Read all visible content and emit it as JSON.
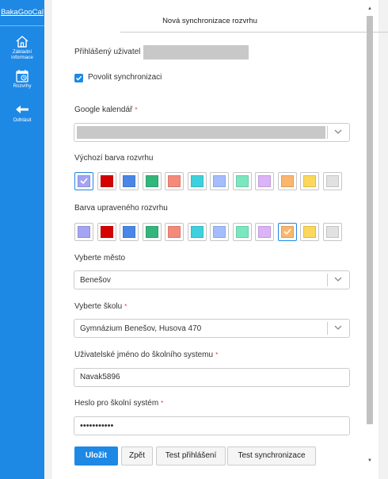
{
  "sidebar": {
    "brand": "BakaGooCal",
    "items": [
      {
        "label_line1": "Základní",
        "label_line2": "informace",
        "icon": "home-icon"
      },
      {
        "label": "Rozvrhy",
        "icon": "calendar-icon"
      },
      {
        "label": "Odhlásit",
        "icon": "arrow-left-icon"
      }
    ]
  },
  "form": {
    "title": "Nová synchronizace rozvrhu",
    "user_label": "Přihlášený uživatel",
    "enable_sync_label": "Povolit synchronizaci",
    "enable_sync_checked": true,
    "google_calendar_label": "Google kalendář",
    "default_color_label": "Výchozí barva rozvrhu",
    "modified_color_label": "Barva upraveného rozvrhu",
    "default_color_selected_index": 0,
    "modified_color_selected_index": 9,
    "city_label": "Vyberte město",
    "city_value": "Benešov",
    "school_label": "Vyberte školu",
    "school_value": "Gymnázium Benešov, Husova 470",
    "username_label": "Uživatelské jméno do školního systemu",
    "username_value": "Navak5896",
    "password_label": "Heslo pro školní systém",
    "password_value": "•••••••••••",
    "required_mark": "*"
  },
  "colors": [
    "#a4a4f4",
    "#d50000",
    "#4a86e8",
    "#33b679",
    "#f58a7a",
    "#3ed1dd",
    "#a4bdfc",
    "#7ae7bf",
    "#dcb3f7",
    "#fbb66b",
    "#fbd75b",
    "#e1e1e1"
  ],
  "buttons": {
    "save": "Uložit",
    "back": "Zpět",
    "test_login": "Test přihlášení",
    "test_sync": "Test synchronizace"
  },
  "accent_color": "#1e88e5"
}
